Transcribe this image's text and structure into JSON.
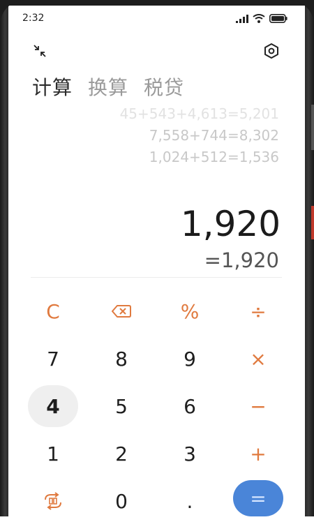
{
  "status": {
    "time": "2:32",
    "icons": [
      "signal-icon",
      "wifi-icon",
      "battery-icon"
    ]
  },
  "toolbar": {
    "collapse_icon": "collapse-icon",
    "settings_icon": "settings-icon"
  },
  "tabs": [
    {
      "label": "计算",
      "active": true
    },
    {
      "label": "换算",
      "active": false
    },
    {
      "label": "税贷",
      "active": false
    }
  ],
  "history": [
    "45+543+4,613=5,201",
    "7,558+744=8,302",
    "1,024+512=1,536"
  ],
  "display": {
    "result": "1,920",
    "equation": "=1,920"
  },
  "keys": [
    {
      "label": "C",
      "type": "op"
    },
    {
      "label": "⌫",
      "type": "op"
    },
    {
      "label": "%",
      "type": "op"
    },
    {
      "label": "÷",
      "type": "op"
    },
    {
      "label": "7",
      "type": "num"
    },
    {
      "label": "8",
      "type": "num"
    },
    {
      "label": "9",
      "type": "num"
    },
    {
      "label": "×",
      "type": "op"
    },
    {
      "label": "4",
      "type": "num"
    },
    {
      "label": "5",
      "type": "num"
    },
    {
      "label": "6",
      "type": "num"
    },
    {
      "label": "−",
      "type": "op"
    },
    {
      "label": "1",
      "type": "num"
    },
    {
      "label": "2",
      "type": "num"
    },
    {
      "label": "3",
      "type": "num"
    },
    {
      "label": "+",
      "type": "op"
    },
    {
      "label": "⇄",
      "type": "op"
    },
    {
      "label": "0",
      "type": "num"
    },
    {
      "label": ".",
      "type": "num"
    },
    {
      "label": "=",
      "type": "eq"
    }
  ],
  "colors": {
    "accent": "#e07a3f",
    "equals_bg": "#4a85d8",
    "selected_key_bg": "#efefef"
  }
}
